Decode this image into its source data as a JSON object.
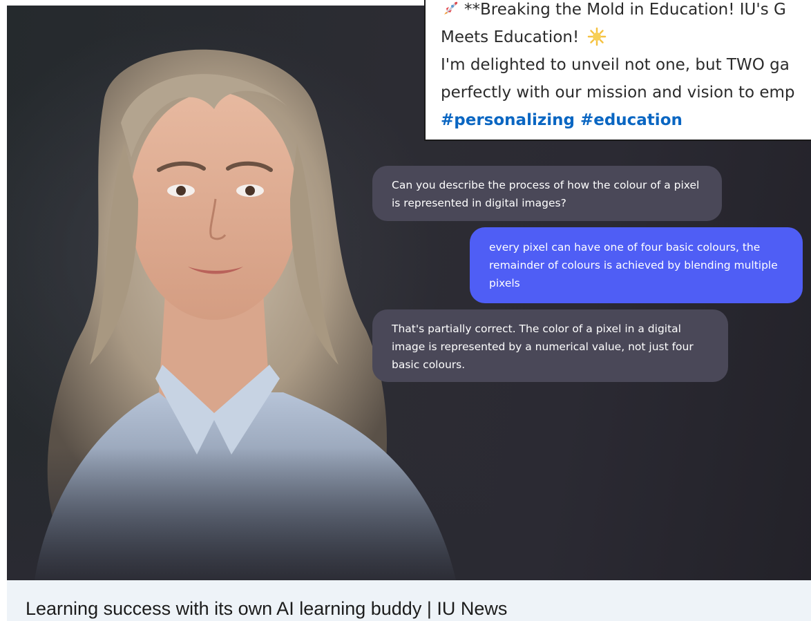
{
  "post": {
    "line1": "**Breaking the Mold in Education! IU's G",
    "line2": "Meets Education!",
    "line3": "I'm delighted to unveil not one, but TWO ga",
    "line4": "perfectly with our mission and vision to emp",
    "hashtags": "#personalizing #education",
    "icons": [
      "rocket-icon",
      "star-icon"
    ]
  },
  "chat": {
    "question_1": "Can you describe the process of how the colour of a pixel is represented in digital images?",
    "answer_1": "every pixel can have one of four basic colours, the remainder of colours is achieved by blending multiple pixels",
    "feedback_1": "That's partially correct. The color of a pixel in a digital image is represented by a numerical value, not just four basic colours."
  },
  "link_card": {
    "title": "Learning success with its own AI learning buddy | IU News"
  },
  "colors": {
    "user_bubble": "#4f5ef5",
    "ai_bubble": "#4a4858",
    "hashtag": "#0a66c2",
    "caption_bg": "#eef3f8"
  }
}
